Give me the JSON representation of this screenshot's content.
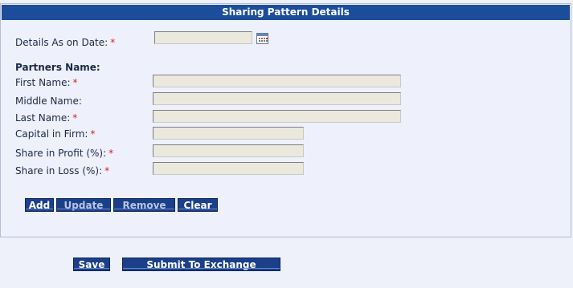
{
  "panel": {
    "title": "Sharing Pattern Details"
  },
  "form": {
    "date": {
      "label": "Details As on Date:",
      "required": "*",
      "value": ""
    },
    "partners_heading": "Partners Name:",
    "first_name": {
      "label": "First Name:",
      "required": "*",
      "value": ""
    },
    "middle_name": {
      "label": "Middle Name:",
      "value": ""
    },
    "last_name": {
      "label": "Last Name:",
      "required": "*",
      "value": ""
    },
    "capital": {
      "label": "Capital in Firm:",
      "required": "*",
      "value": ""
    },
    "share_profit": {
      "label": "Share in Profit (%):",
      "required": "*",
      "value": ""
    },
    "share_loss": {
      "label": "Share in Loss (%):",
      "required": "*",
      "value": ""
    }
  },
  "actions": {
    "add": "Add",
    "update": "Update",
    "remove": "Remove",
    "clear": "Clear"
  },
  "footer": {
    "save": "Save",
    "submit": "Submit To Exchange"
  },
  "colors": {
    "header_bg": "#1b4d9b",
    "button_bg": "#1b3f88",
    "required": "#d9201c",
    "field_bg": "#ebe9de"
  },
  "icons": {
    "calendar": "calendar-icon"
  }
}
